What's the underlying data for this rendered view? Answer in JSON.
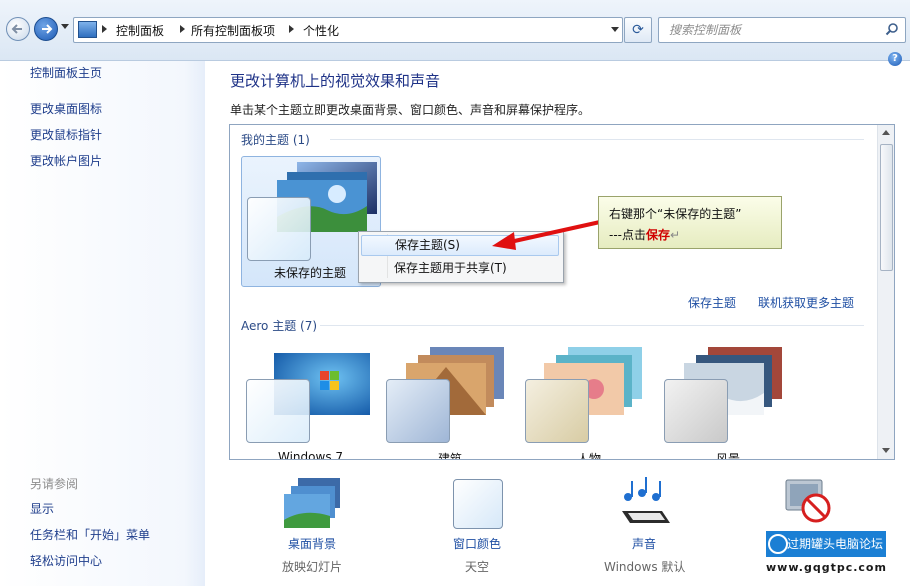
{
  "address_bar": {
    "breadcrumbs": [
      "控制面板",
      "所有控制面板项",
      "个性化"
    ],
    "search_placeholder": "搜索控制面板"
  },
  "left_pane": {
    "links": [
      "控制面板主页",
      "更改桌面图标",
      "更改鼠标指针",
      "更改帐户图片"
    ],
    "see_also_heading": "另请参阅",
    "see_also_links": [
      "显示",
      "任务栏和「开始」菜单",
      "轻松访问中心"
    ]
  },
  "main": {
    "title": "更改计算机上的视觉效果和声音",
    "subtitle": "单击某个主题立即更改桌面背景、窗口颜色、声音和屏幕保护程序。",
    "my_themes_heading": "我的主题 (1)",
    "unsaved_theme_label": "未保存的主题",
    "save_theme_link": "保存主题",
    "get_more_link": "联机获取更多主题",
    "aero_heading": "Aero 主题 (7)",
    "aero_themes": [
      "Windows 7",
      "建筑",
      "人物",
      "风景"
    ]
  },
  "context_menu": {
    "items": [
      "保存主题(S)",
      "保存主题用于共享(T)"
    ]
  },
  "callout": {
    "line1": "右键那个“未保存的主题”",
    "line2_prefix": "---点击",
    "line2_highlight": "保存",
    "line2_suffix": "↵"
  },
  "bottom": {
    "items": [
      {
        "label": "桌面背景",
        "sub": "放映幻灯片"
      },
      {
        "label": "窗口颜色",
        "sub": "天空"
      },
      {
        "label": "声音",
        "sub": "Windows 默认"
      }
    ]
  },
  "watermark": {
    "line1": "过期罐头电脑论坛",
    "line2": "www.gqgtpc.com"
  },
  "colors": {
    "link": "#1f4fa3",
    "title": "#1e3287",
    "callout_highlight": "#d00000"
  }
}
